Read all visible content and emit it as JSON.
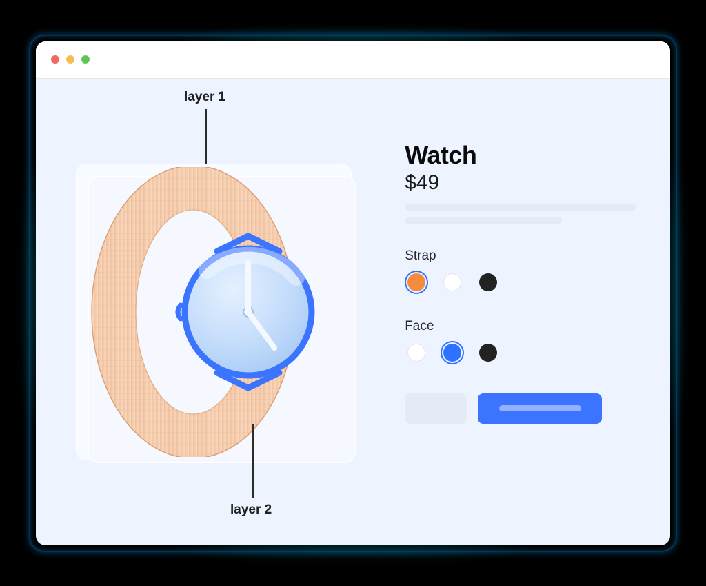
{
  "annotations": {
    "layer1": "layer 1",
    "layer2": "layer 2"
  },
  "product": {
    "title": "Watch",
    "price": "$49"
  },
  "options": {
    "strap": {
      "label": "Strap",
      "colors": [
        "orange",
        "white",
        "black"
      ],
      "selected": "orange"
    },
    "face": {
      "label": "Face",
      "colors": [
        "white",
        "blue",
        "black"
      ],
      "selected": "blue"
    }
  },
  "colors": {
    "accent": "#2f72ff",
    "strap_orange": "#f5b48a",
    "face_blue_light": "#c6defb",
    "face_blue_rim": "#3a74ff"
  }
}
